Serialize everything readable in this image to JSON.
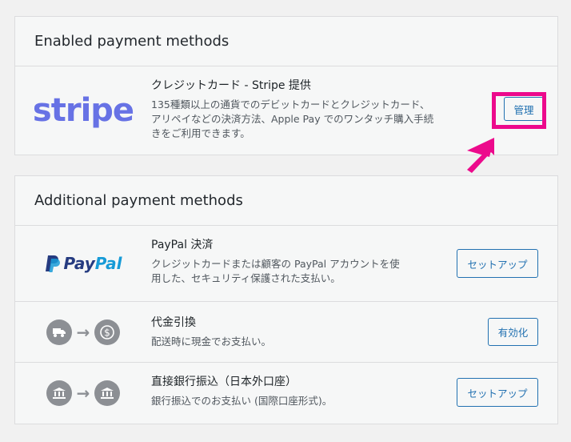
{
  "enabled": {
    "heading": "Enabled payment methods",
    "stripe": {
      "logo_text": "stripe",
      "title": "クレジットカード - Stripe 提供",
      "desc_line1": "135種類以上の通貨でのデビットカードとクレジットカード、",
      "desc_line2": "アリペイなどの決済方法、Apple Pay でのワンタッチ購入手続",
      "desc_line3": "きをご利用できます。",
      "button": "管理"
    }
  },
  "additional": {
    "heading": "Additional payment methods",
    "paypal": {
      "logo_text_pay": "Pay",
      "logo_text_pal": "Pal",
      "title": "PayPal 決済",
      "desc_line1": "クレジットカードまたは顧客の PayPal アカウントを使",
      "desc_line2": "用した、セキュリティ保護された支払い。",
      "button": "セットアップ"
    },
    "cod": {
      "title": "代金引換",
      "desc": "配送時に現金でお支払い。",
      "button": "有効化"
    },
    "bank": {
      "title": "直接銀行振込（日本外口座）",
      "desc": "銀行振込でのお支払い (国際口座形式)。",
      "button": "セットアップ"
    }
  },
  "colors": {
    "highlight": "#ec0a8c",
    "stripe": "#6772e5",
    "button": "#2271b1"
  }
}
